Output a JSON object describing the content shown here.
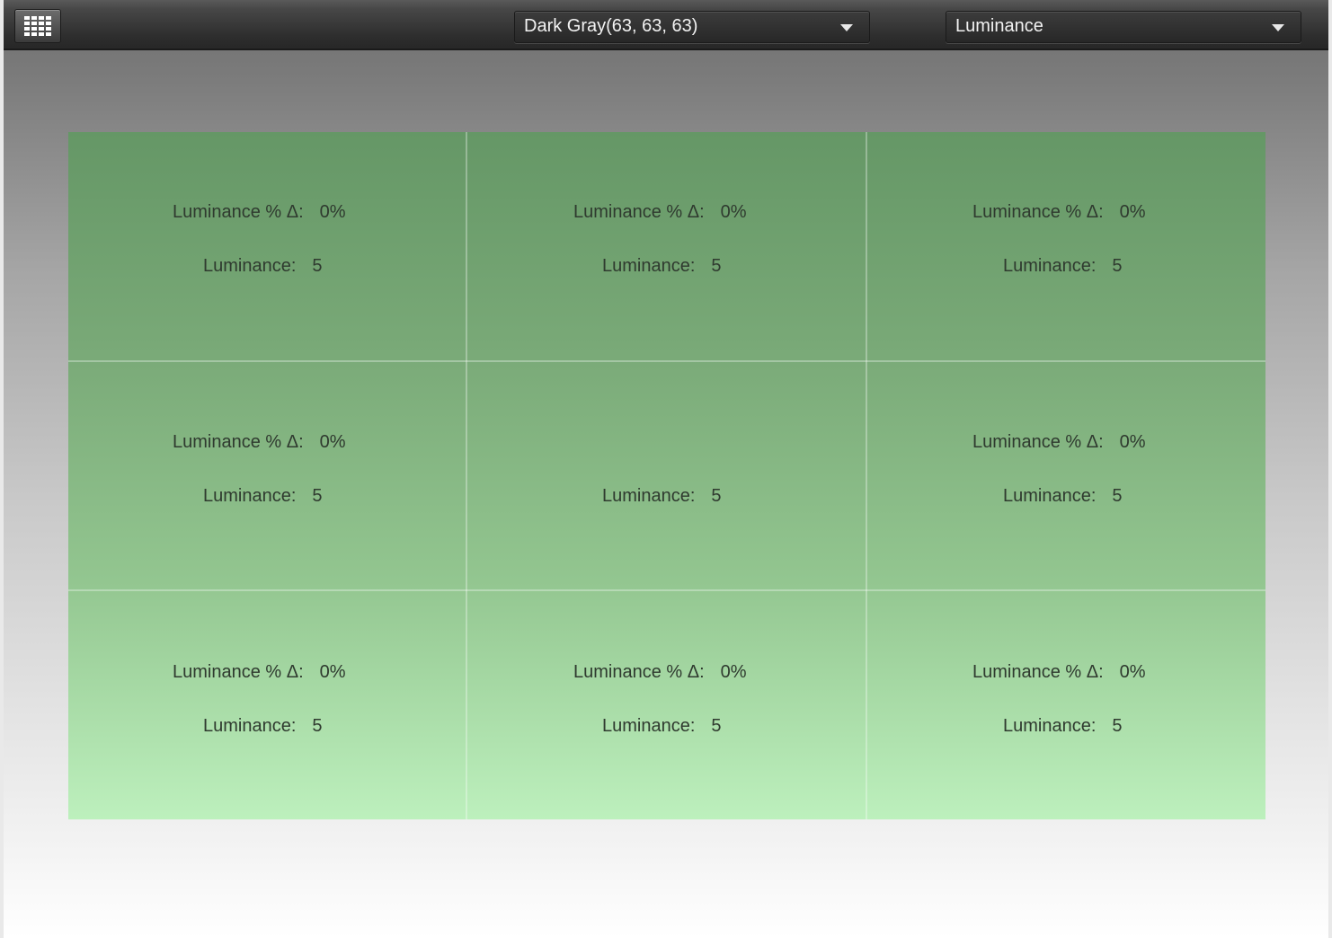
{
  "toolbar": {
    "color_dropdown": {
      "selected": "Dark Gray(63, 63, 63)"
    },
    "mode_dropdown": {
      "selected": "Luminance"
    }
  },
  "grid": {
    "cells": [
      {
        "delta_label": "Luminance % Δ:",
        "delta_value": "0%",
        "lum_label": "Luminance:",
        "lum_value": "5"
      },
      {
        "delta_label": "Luminance % Δ:",
        "delta_value": "0%",
        "lum_label": "Luminance:",
        "lum_value": "5"
      },
      {
        "delta_label": "Luminance % Δ:",
        "delta_value": "0%",
        "lum_label": "Luminance:",
        "lum_value": "5"
      },
      {
        "delta_label": "Luminance % Δ:",
        "delta_value": "0%",
        "lum_label": "Luminance:",
        "lum_value": "5"
      },
      {
        "delta_label": "",
        "delta_value": "",
        "lum_label": "Luminance:",
        "lum_value": "5"
      },
      {
        "delta_label": "Luminance % Δ:",
        "delta_value": "0%",
        "lum_label": "Luminance:",
        "lum_value": "5"
      },
      {
        "delta_label": "Luminance % Δ:",
        "delta_value": "0%",
        "lum_label": "Luminance:",
        "lum_value": "5"
      },
      {
        "delta_label": "Luminance % Δ:",
        "delta_value": "0%",
        "lum_label": "Luminance:",
        "lum_value": "5"
      },
      {
        "delta_label": "Luminance % Δ:",
        "delta_value": "0%",
        "lum_label": "Luminance:",
        "lum_value": "5"
      }
    ]
  },
  "icons": {
    "grid_toggle": "grid-icon",
    "dropdown_arrow": "chevron-down-icon"
  },
  "colors": {
    "panel_top": "#659766",
    "panel_bottom": "#bdf0bd",
    "text": "#2f3a2f"
  }
}
